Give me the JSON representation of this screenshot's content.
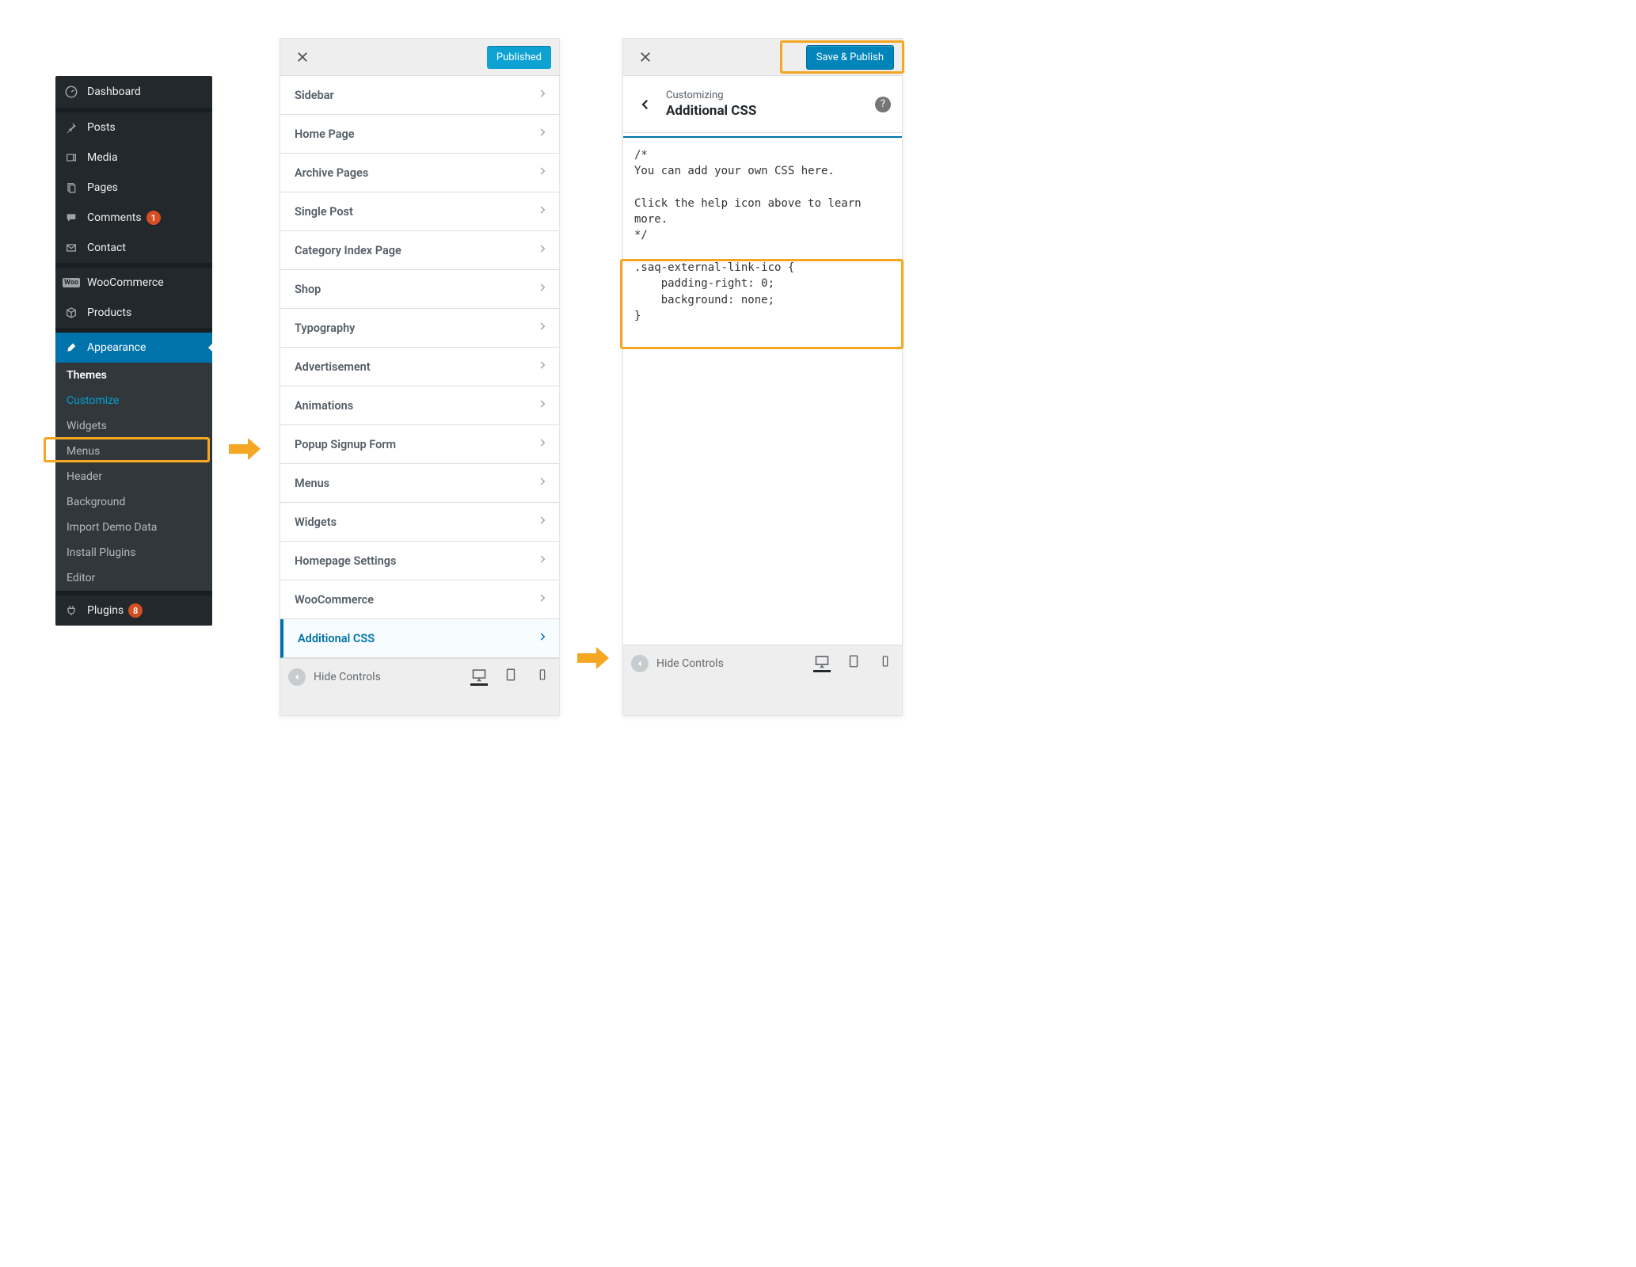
{
  "sidebar": {
    "items": [
      {
        "label": "Dashboard",
        "icon": "dashboard"
      },
      {
        "label": "Posts",
        "icon": "pin"
      },
      {
        "label": "Media",
        "icon": "media"
      },
      {
        "label": "Pages",
        "icon": "pages"
      },
      {
        "label": "Comments",
        "icon": "comment",
        "badge": "1"
      },
      {
        "label": "Contact",
        "icon": "envelope"
      },
      {
        "label": "WooCommerce",
        "icon": "woo"
      },
      {
        "label": "Products",
        "icon": "product"
      },
      {
        "label": "Appearance",
        "icon": "brush",
        "active": true
      },
      {
        "label": "Plugins",
        "icon": "plug",
        "badge": "8"
      }
    ],
    "appearance_sub": [
      {
        "label": "Themes",
        "current": true
      },
      {
        "label": "Customize",
        "highlight": true
      },
      {
        "label": "Widgets"
      },
      {
        "label": "Menus"
      },
      {
        "label": "Header"
      },
      {
        "label": "Background"
      },
      {
        "label": "Import Demo Data"
      },
      {
        "label": "Install Plugins"
      },
      {
        "label": "Editor"
      }
    ]
  },
  "customizer_left": {
    "publish_label": "Published",
    "items": [
      "Sidebar",
      "Home Page",
      "Archive Pages",
      "Single Post",
      "Category Index Page",
      "Shop",
      "Typography",
      "Advertisement",
      "Animations",
      "Popup Signup Form",
      "Menus",
      "Widgets",
      "Homepage Settings",
      "WooCommerce",
      "Additional CSS"
    ],
    "selected": "Additional CSS",
    "hide_controls": "Hide Controls"
  },
  "customizer_right": {
    "save_label": "Save & Publish",
    "overline": "Customizing",
    "title": "Additional CSS",
    "hide_controls": "Hide Controls",
    "css_text": "/*\nYou can add your own CSS here.\n\nClick the help icon above to learn\nmore.\n*/\n\n.saq-external-link-ico {\n    padding-right: 0;\n    background: none;\n}"
  }
}
